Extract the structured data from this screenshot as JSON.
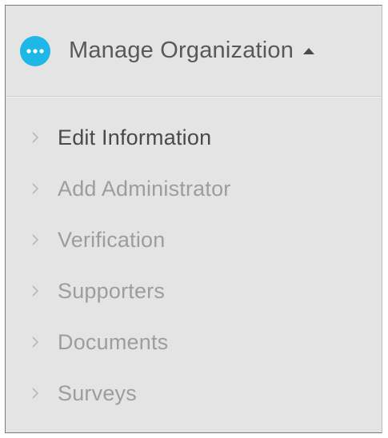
{
  "panel": {
    "title": "Manage Organization",
    "icon": "more-horizontal-icon",
    "caret_icon": "caret-up-icon",
    "accent_color": "#1fb6e8"
  },
  "menu": {
    "items": [
      {
        "label": "Edit Information",
        "active": true
      },
      {
        "label": "Add Administrator",
        "active": false
      },
      {
        "label": "Verification",
        "active": false
      },
      {
        "label": "Supporters",
        "active": false
      },
      {
        "label": "Documents",
        "active": false
      },
      {
        "label": "Surveys",
        "active": false
      }
    ]
  }
}
